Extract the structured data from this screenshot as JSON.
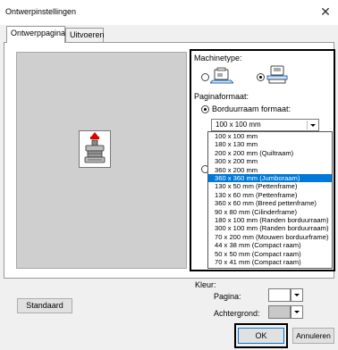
{
  "window": {
    "title": "Ontwerpinstellingen",
    "close_glyph": "✕"
  },
  "tabs": [
    {
      "label": "Ontwerppagina",
      "active": true
    },
    {
      "label": "Uitvoeren",
      "active": false
    }
  ],
  "machine_type": {
    "label": "Machinetype:",
    "options": [
      {
        "icon": "flat-sewing-machine-icon",
        "selected": false
      },
      {
        "icon": "embroidery-machine-icon",
        "selected": true
      }
    ]
  },
  "page_format": {
    "label": "Paginaformaat:",
    "hoop_option_label": "Borduurraam formaat:",
    "selected_value": "100 x 100 mm",
    "dropdown_items": [
      "100 x 100 mm",
      "180 x 130 mm",
      "200 x 200 mm (Quiltraam)",
      "300 x 200 mm",
      "360 x 200 mm",
      "360 x 360 mm (Jumboraam)",
      "130 x  50 mm (Pettenframe)",
      "130 x  60 mm (Pettenframe)",
      "360 x  60 mm (Breed pettenframe)",
      " 90 x  80 mm (Cilinderframe)",
      "180 x 100 mm (Randen borduurraam)",
      "300 x 100 mm (Randen borduurraam)",
      " 70 x 200 mm (Mouwen borduurframe)",
      " 44 x  38 mm (Compact raam)",
      " 50 x  50 mm (Compact raam)",
      " 70 x  41 mm (Compact raam)"
    ],
    "highlighted_index": 5
  },
  "color": {
    "label": "Kleur:",
    "page_label": "Pagina:",
    "page_color": "#ffffff",
    "background_label": "Achtergrond:",
    "background_color": "#c8c8c8"
  },
  "buttons": {
    "default": "Standaard",
    "ok": "OK",
    "cancel": "Annuleren"
  }
}
